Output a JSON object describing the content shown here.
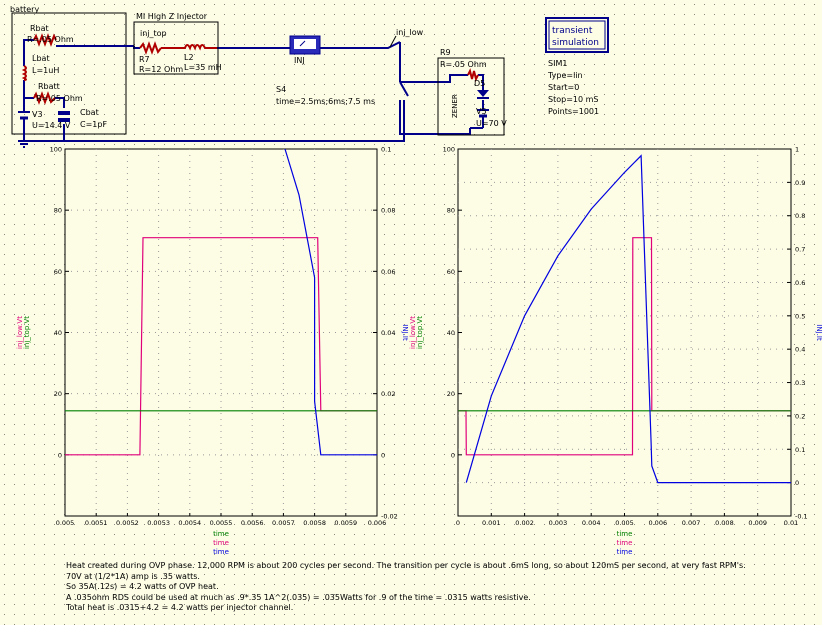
{
  "schematic": {
    "battery_label": "battery",
    "rbat": {
      "name": "Rbat",
      "value": "R=.05 Ohm"
    },
    "lbat": {
      "name": "Lbat",
      "value": "L=1uH"
    },
    "rbatt": {
      "name": "Rbatt",
      "value": "R=.05 Ohm"
    },
    "v3": {
      "name": "V3",
      "value": "U=14.4 V"
    },
    "cbat": {
      "name": "Cbat",
      "value": "C=1pF"
    },
    "injector_box_label": "MI High Z Injector",
    "inj_top_label": "inj_top",
    "r7": {
      "name": "R7",
      "value": "R=12 Ohm"
    },
    "l2": {
      "name": "L2",
      "value": "L=35 mH"
    },
    "inj_ammeter_label": "INJ",
    "s4": {
      "name": "S4",
      "value": "time=2.5ms;6ms;7.5 ms"
    },
    "inj_low_label": "inj_low",
    "r9": {
      "name": "R9",
      "value": "R=.05 Ohm"
    },
    "d5": {
      "name": "D5"
    },
    "d5_part": "ZENER",
    "v5": {
      "name": "V5",
      "value": "U=70 V"
    },
    "sim_box_label": "transient simulation",
    "sim_params": [
      "SIM1",
      "Type=lin",
      "Start=0",
      "Stop=10 mS",
      "Points=1001"
    ]
  },
  "chart_data": [
    {
      "type": "line",
      "title": "",
      "xlabel": "time",
      "ylabel_left": [
        "inj_low.Vt",
        "inj_top.Vt"
      ],
      "ylabel_right": "INJ.It",
      "x_ticks": [
        "0.005",
        "0.0051",
        "0.0052",
        "0.0053",
        "0.0054",
        "0.0055",
        "0.0056",
        "0.0057",
        "0.0058",
        "0.0059",
        "0.006"
      ],
      "y_left_ticks": [
        "0",
        "20",
        "40",
        "60",
        "80",
        "100"
      ],
      "y_right_ticks": [
        "-0.02",
        "0",
        "0.02",
        "0.04",
        "0.06",
        "0.08",
        "0.1"
      ],
      "xlim": [
        0.005,
        0.006
      ],
      "ylim_left": [
        -20,
        100
      ],
      "ylim_right": [
        -0.02,
        0.1
      ],
      "grid": true,
      "colors": {
        "inj_low": "#e0007a",
        "inj_top": "#008000",
        "current": "#0000e0"
      },
      "series": [
        {
          "name": "inj_low.Vt",
          "axis": "left",
          "color": "#e0007a",
          "x": [
            0.005,
            0.00524,
            0.00525,
            0.00581,
            0.00582,
            0.006
          ],
          "y": [
            0,
            0,
            71,
            71,
            14.4,
            14.4
          ]
        },
        {
          "name": "inj_top.Vt",
          "axis": "left",
          "color": "#008000",
          "x": [
            0.005,
            0.006
          ],
          "y": [
            14.4,
            14.4
          ]
        },
        {
          "name": "INJ.It",
          "axis": "right",
          "color": "#0000e0",
          "x": [
            0.005705,
            0.00575,
            0.0058,
            0.0058,
            0.00582,
            0.006
          ],
          "y": [
            0.1,
            0.085,
            0.058,
            0.0175,
            0,
            0
          ]
        }
      ]
    },
    {
      "type": "line",
      "title": "",
      "xlabel": "time",
      "ylabel_left": [
        "inj_low.Vt",
        "inj_top.Vt"
      ],
      "ylabel_right": "INJ.It",
      "x_ticks": [
        "0",
        "0.001",
        "0.002",
        "0.003",
        "0.004",
        "0.005",
        "0.006",
        "0.007",
        "0.008",
        "0.009",
        "0.01"
      ],
      "y_left_ticks": [
        "0",
        "20",
        "40",
        "60",
        "80",
        "100"
      ],
      "y_right_ticks": [
        "-0.1",
        "0",
        "0.1",
        "0.2",
        "0.3",
        "0.4",
        "0.5",
        "0.6",
        "0.7",
        "0.8",
        "0.9",
        "1"
      ],
      "xlim": [
        0,
        0.01
      ],
      "ylim_left": [
        -20,
        100
      ],
      "ylim_right": [
        -0.1,
        1
      ],
      "grid": true,
      "colors": {
        "inj_low": "#e0007a",
        "inj_top": "#008000",
        "current": "#0000e0"
      },
      "series": [
        {
          "name": "inj_low.Vt",
          "axis": "left",
          "color": "#e0007a",
          "x": [
            0,
            0.00024,
            0.00025,
            0.00524,
            0.00525,
            0.00581,
            0.00582,
            0.01
          ],
          "y": [
            14.4,
            14.4,
            0,
            0,
            71,
            71,
            14.4,
            14.4
          ]
        },
        {
          "name": "inj_top.Vt",
          "axis": "left",
          "color": "#008000",
          "x": [
            0,
            0.01
          ],
          "y": [
            14.4,
            14.4
          ]
        },
        {
          "name": "INJ.It",
          "axis": "right",
          "color": "#0000e0",
          "x": [
            0.00025,
            0.001,
            0.002,
            0.003,
            0.004,
            0.005,
            0.0055,
            0.0058,
            0.00582,
            0.006,
            0.01
          ],
          "y": [
            0,
            0.26,
            0.5,
            0.68,
            0.82,
            0.93,
            0.98,
            0.12,
            0.05,
            0,
            0
          ]
        }
      ]
    }
  ],
  "notes": [
    "Heat created during OVP phase. 12,000 RPM is about 200 cycles per second. The transition per cycle is about .6mS long, so about 120mS per second, at very fast RPM's.",
    "70V at (1/2*1A) amp is .35 watts.",
    "So 35A(.12s) = 4.2 watts of OVP heat.",
    "A .035ohm RDS could be used at much as .9*.35 1A^2(.035) = .035Watts for .9 of the time = .0315 watts resistive.",
    "Total heat is .0315+4.2 = 4.2 watts per injector channel."
  ]
}
